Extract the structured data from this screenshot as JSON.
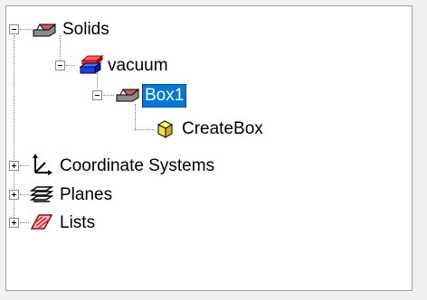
{
  "tree": {
    "solids": {
      "label": "Solids",
      "expanded": true
    },
    "vacuum": {
      "label": "vacuum",
      "expanded": true
    },
    "box1": {
      "label": "Box1",
      "expanded": true,
      "selected": true
    },
    "createbox": {
      "label": "CreateBox"
    },
    "coordinate_systems": {
      "label": "Coordinate Systems",
      "expanded": false
    },
    "planes": {
      "label": "Planes",
      "expanded": false
    },
    "lists": {
      "label": "Lists",
      "expanded": false
    }
  },
  "icons": {
    "solids": "solid-box-icon",
    "vacuum": "material-layers-icon",
    "box1": "solid-box-icon",
    "createbox": "create-box-command-icon",
    "coordinate_systems": "coordinate-axes-icon",
    "planes": "plane-stack-icon",
    "lists": "list-icon"
  },
  "colors": {
    "selection": "#0078d7",
    "vacuum_red": "#e53030",
    "vacuum_blue": "#2040e0"
  }
}
